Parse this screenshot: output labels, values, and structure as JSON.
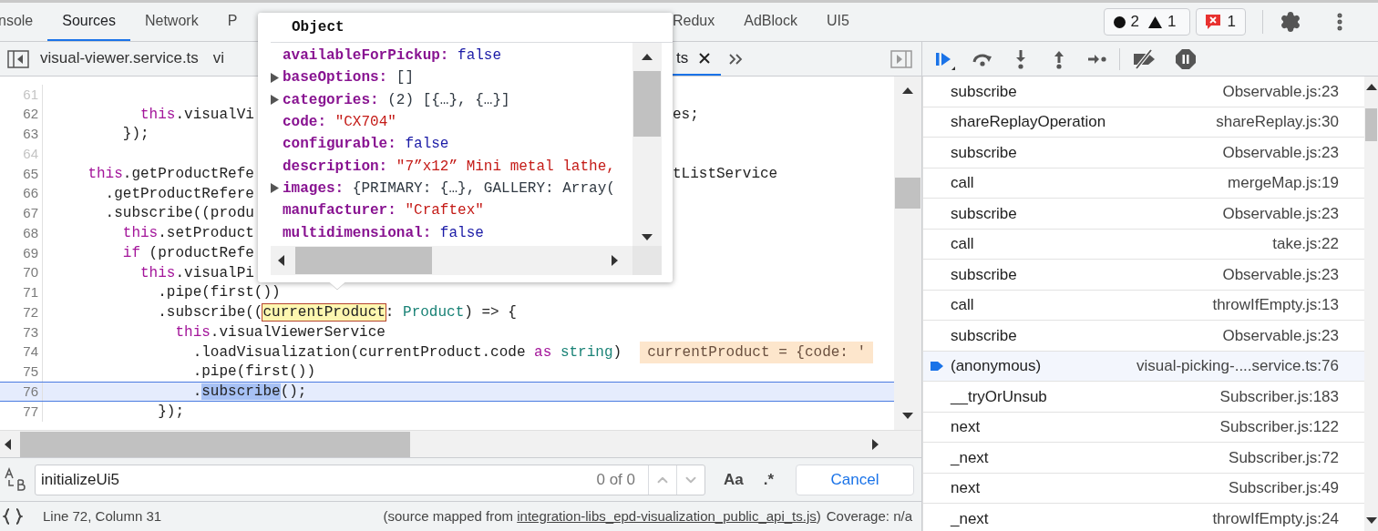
{
  "tabs_before_popover": [
    {
      "label": "nsole",
      "selected": false
    },
    {
      "label": "Sources",
      "selected": true
    },
    {
      "label": "Network",
      "selected": false
    },
    {
      "label": "P",
      "selected": false
    }
  ],
  "tabs_after_popover": [
    {
      "label": "Redux",
      "selected": false
    },
    {
      "label": "AdBlock",
      "selected": false
    },
    {
      "label": "UI5",
      "selected": false
    }
  ],
  "issue_counts": [
    {
      "kind": "info",
      "count": "2"
    },
    {
      "kind": "warning",
      "count": "1"
    }
  ],
  "error_count": "1",
  "file_tabs_before_popover": [
    {
      "label": "visual-viewer.service.ts",
      "selected": false,
      "closable": false
    },
    {
      "label": "vi",
      "selected": false,
      "closable": false
    }
  ],
  "file_tabs_after_popover": [
    {
      "label": "ts",
      "selected": true,
      "closable": true
    }
  ],
  "code_lines": [
    {
      "number": "61"
    },
    {
      "number": "62",
      "tokens": [
        {
          "text": "          this",
          "kind": "keyword"
        },
        {
          "text": ".visualVi",
          "kind": "plain"
        }
      ],
      "tail": [
        {
          "text": "es;",
          "kind": "plain"
        }
      ]
    },
    {
      "number": "63",
      "tokens": [
        {
          "text": "        });",
          "kind": "plain"
        }
      ]
    },
    {
      "number": "64"
    },
    {
      "number": "65",
      "tokens": [
        {
          "text": "    this",
          "kind": "keyword"
        },
        {
          "text": ".getProductRefe",
          "kind": "plain"
        }
      ],
      "tail": [
        {
          "text": "tListService",
          "kind": "plain"
        }
      ]
    },
    {
      "number": "66",
      "tokens": [
        {
          "text": "      .getProductRefere",
          "kind": "plain"
        }
      ]
    },
    {
      "number": "67",
      "tokens": [
        {
          "text": "      .subscribe((produ",
          "kind": "plain"
        }
      ]
    },
    {
      "number": "68",
      "tokens": [
        {
          "text": "        this",
          "kind": "keyword"
        },
        {
          "text": ".setProduct",
          "kind": "plain"
        }
      ]
    },
    {
      "number": "69",
      "tokens": [
        {
          "text": "        if",
          "kind": "keyword"
        },
        {
          "text": " (productRefe",
          "kind": "plain"
        }
      ]
    },
    {
      "number": "70",
      "tokens": [
        {
          "text": "          this",
          "kind": "keyword"
        },
        {
          "text": ".visualPi",
          "kind": "plain"
        }
      ]
    },
    {
      "number": "71",
      "tokens": [
        {
          "text": "            .pipe(first())",
          "kind": "plain"
        }
      ]
    },
    {
      "number": "72",
      "tokens": [
        {
          "text": "            .subscribe((",
          "kind": "plain"
        },
        {
          "text": "currentProduct",
          "kind": "hovered"
        },
        {
          "text": ": ",
          "kind": "plain"
        },
        {
          "text": "Product",
          "kind": "type"
        },
        {
          "text": ") => {",
          "kind": "plain"
        }
      ]
    },
    {
      "number": "73",
      "tokens": [
        {
          "text": "              this",
          "kind": "keyword"
        },
        {
          "text": ".visualViewerService",
          "kind": "plain"
        }
      ]
    },
    {
      "number": "74",
      "tokens": [
        {
          "text": "                .loadVisualization(currentProduct.code ",
          "kind": "plain"
        },
        {
          "text": "as",
          "kind": "keyword"
        },
        {
          "text": " string",
          "kind": "type"
        },
        {
          "text": ")",
          "kind": "plain"
        }
      ],
      "inline_value": "currentProduct = {code: '"
    },
    {
      "number": "75",
      "tokens": [
        {
          "text": "                .pipe(first())",
          "kind": "plain"
        }
      ]
    },
    {
      "number": "76",
      "current": true,
      "tokens": [
        {
          "text": "                .",
          "kind": "plain"
        },
        {
          "text": "subscribe",
          "kind": "match"
        },
        {
          "text": "();",
          "kind": "plain"
        }
      ]
    },
    {
      "number": "77",
      "tokens": [
        {
          "text": "            });",
          "kind": "plain"
        }
      ]
    }
  ],
  "popover": {
    "title": "Object",
    "properties": [
      {
        "name": "availableForPickup:",
        "value": "false",
        "kind": "boolean",
        "expandable": false
      },
      {
        "name": "baseOptions:",
        "value": "[]",
        "kind": "object",
        "expandable": true
      },
      {
        "name": "categories:",
        "value": "(2) [{…}, {…}]",
        "kind": "object",
        "expandable": true
      },
      {
        "name": "code:",
        "value": "\"CX704\"",
        "kind": "string",
        "expandable": false
      },
      {
        "name": "configurable:",
        "value": "false",
        "kind": "boolean",
        "expandable": false
      },
      {
        "name": "description:",
        "value": "\"7”x12” Mini metal lathe,",
        "kind": "string",
        "expandable": false
      },
      {
        "name": "images:",
        "value": "{PRIMARY: {…}, GALLERY: Array(",
        "kind": "object",
        "expandable": true
      },
      {
        "name": "manufacturer:",
        "value": "\"Craftex\"",
        "kind": "string",
        "expandable": false
      },
      {
        "name": "multidimensional:",
        "value": "false",
        "kind": "boolean",
        "expandable": false
      }
    ]
  },
  "call_stack": [
    {
      "name": "subscribe",
      "location": "Observable.js:23",
      "current": false
    },
    {
      "name": "shareReplayOperation",
      "location": "shareReplay.js:30",
      "current": false
    },
    {
      "name": "subscribe",
      "location": "Observable.js:23",
      "current": false
    },
    {
      "name": "call",
      "location": "mergeMap.js:19",
      "current": false
    },
    {
      "name": "subscribe",
      "location": "Observable.js:23",
      "current": false
    },
    {
      "name": "call",
      "location": "take.js:22",
      "current": false
    },
    {
      "name": "subscribe",
      "location": "Observable.js:23",
      "current": false
    },
    {
      "name": "call",
      "location": "throwIfEmpty.js:13",
      "current": false
    },
    {
      "name": "subscribe",
      "location": "Observable.js:23",
      "current": false
    },
    {
      "name": "(anonymous)",
      "location": "visual-picking-....service.ts:76",
      "current": true
    },
    {
      "name": "__tryOrUnsub",
      "location": "Subscriber.js:183",
      "current": false
    },
    {
      "name": "next",
      "location": "Subscriber.js:122",
      "current": false
    },
    {
      "name": "_next",
      "location": "Subscriber.js:72",
      "current": false
    },
    {
      "name": "next",
      "location": "Subscriber.js:49",
      "current": false
    },
    {
      "name": "_next",
      "location": "throwIfEmpty.js:24",
      "current": false
    }
  ],
  "search": {
    "value": "initializeUi5",
    "match_count": "0 of 0",
    "match_case": "Aa",
    "regex": ".*",
    "cancel": "Cancel"
  },
  "status_bar": {
    "position": "Line 72, Column 31",
    "source_prefix": "(source mapped from ",
    "source_link": "integration-libs_epd-visualization_public_api_ts.js",
    "source_suffix": ")",
    "coverage": "Coverage: n/a"
  }
}
